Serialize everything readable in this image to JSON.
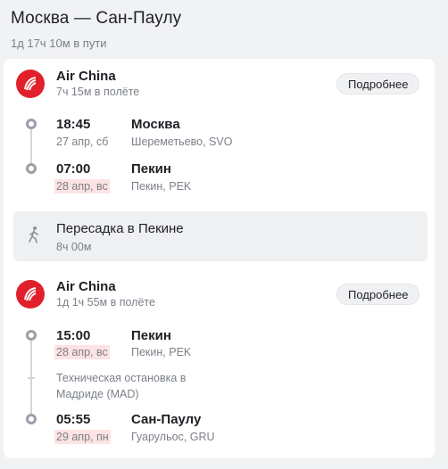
{
  "header": {
    "title": "Москва — Сан-Паулу",
    "total_duration": "1д 17ч 10м в пути"
  },
  "colors": {
    "accent_logo": "#e0202a",
    "date_highlight": "#fde3e3"
  },
  "segments": [
    {
      "airline": "Air China",
      "duration": "7ч 15м в полёте",
      "details_label": "Подробнее",
      "departure": {
        "time": "18:45",
        "date": "27 апр, сб",
        "city": "Москва",
        "airport": "Шереметьево, SVO"
      },
      "arrival": {
        "time": "07:00",
        "date": "28 апр, вс",
        "city": "Пекин",
        "airport": "Пекин, PEK"
      }
    },
    {
      "airline": "Air China",
      "duration": "1д 1ч 55м в полёте",
      "details_label": "Подробнее",
      "departure": {
        "time": "15:00",
        "date": "28 апр, вс",
        "city": "Пекин",
        "airport": "Пекин, PEK"
      },
      "technical_stop": "Техническая остановка в Мадриде (MAD)",
      "arrival": {
        "time": "05:55",
        "date": "29 апр, пн",
        "city": "Сан-Паулу",
        "airport": "Гуарульос, GRU"
      }
    }
  ],
  "layover": {
    "icon": "walking-person-icon",
    "title": "Пересадка в Пекине",
    "duration": "8ч 00м"
  }
}
